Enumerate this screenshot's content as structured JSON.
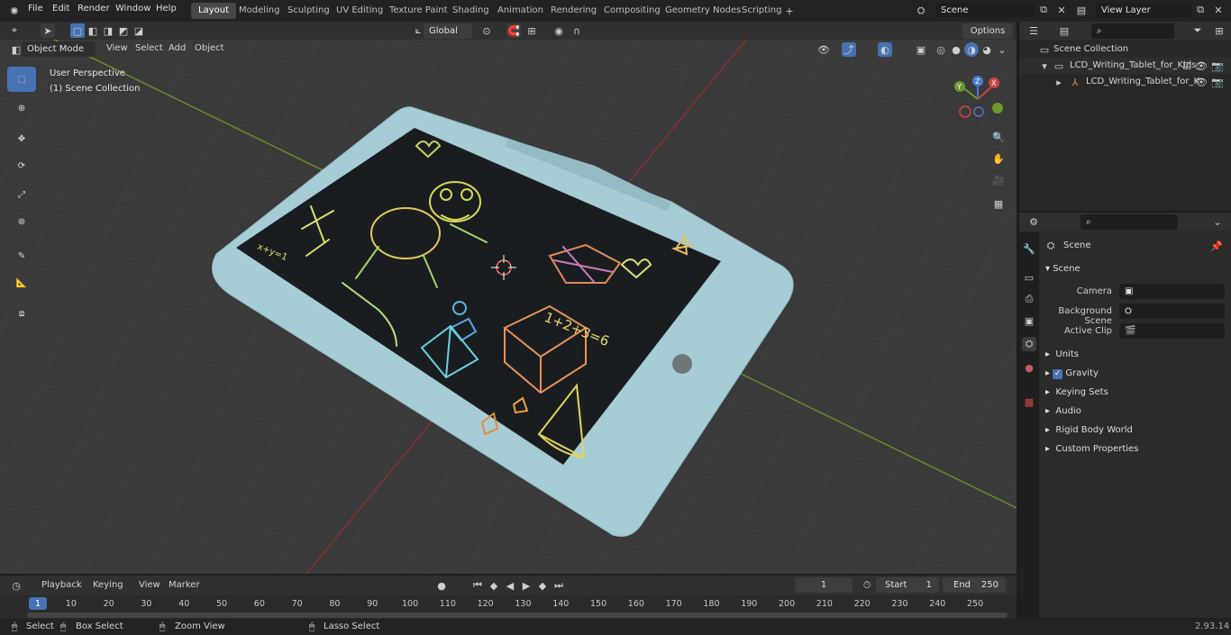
{
  "menu": [
    "File",
    "Edit",
    "Render",
    "Window",
    "Help"
  ],
  "workspaces": [
    "Layout",
    "Modeling",
    "Sculpting",
    "UV Editing",
    "Texture Paint",
    "Shading",
    "Animation",
    "Rendering",
    "Compositing",
    "Geometry Nodes",
    "Scripting"
  ],
  "active_workspace": "Layout",
  "scene_name": "Scene",
  "view_layer": "View Layer",
  "viewport": {
    "mode": "Object Mode",
    "menus": [
      "View",
      "Select",
      "Add",
      "Object"
    ],
    "transform_orientation": "Global",
    "options_label": "Options",
    "overlay_text_1": "User Perspective",
    "overlay_text_2": "(1) Scene Collection",
    "drawing_text": "1+2+3=6",
    "drawing_text_2": "x+y=1"
  },
  "outliner": {
    "root": "Scene Collection",
    "item1": "LCD_Writing_Tablet_for_Kids_",
    "item2": "LCD_Writing_Tablet_for_K"
  },
  "properties": {
    "header": "Scene",
    "panel": "Scene",
    "camera_label": "Camera",
    "bg_scene_label": "Background Scene",
    "active_clip_label": "Active Clip",
    "sections": [
      "Units",
      "Gravity",
      "Keying Sets",
      "Audio",
      "Rigid Body World",
      "Custom Properties"
    ]
  },
  "timeline": {
    "menus": [
      "Playback",
      "Keying",
      "View",
      "Marker"
    ],
    "current_frame": "1",
    "start_label": "Start",
    "start": "1",
    "end_label": "End",
    "end": "250",
    "ticks": [
      "1",
      "10",
      "20",
      "30",
      "40",
      "50",
      "60",
      "70",
      "80",
      "90",
      "100",
      "110",
      "120",
      "130",
      "140",
      "150",
      "160",
      "170",
      "180",
      "190",
      "200",
      "210",
      "220",
      "230",
      "240",
      "250"
    ]
  },
  "status": {
    "select": "Select",
    "box_select": "Box Select",
    "zoom_view": "Zoom View",
    "lasso_select": "Lasso Select",
    "version": "2.93.14"
  },
  "colors": {
    "accent": "#4772b3",
    "tablet": "#a6cdd6",
    "screen": "#1a1d20",
    "grid_x": "#8b2e2e",
    "grid_y": "#6b8a2a"
  }
}
